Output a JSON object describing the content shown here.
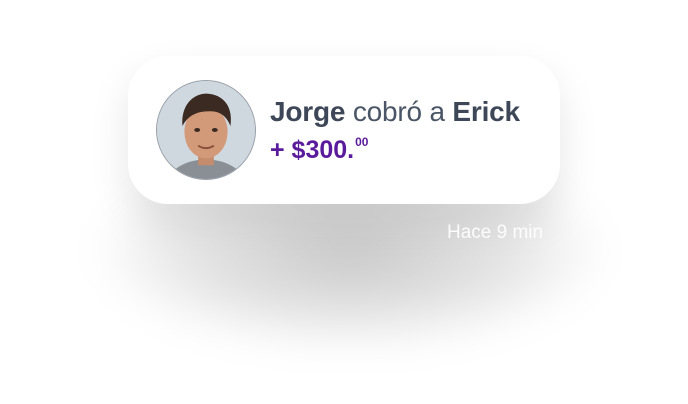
{
  "notification": {
    "sender": "Jorge",
    "verb": " cobró a ",
    "recipient": "Erick",
    "amount_main": "+ $300.",
    "amount_cents": "00",
    "time_ago": "Hace 9 min"
  },
  "colors": {
    "amount": "#5a1a9c",
    "text": "#4a5566"
  },
  "icons": {
    "avatar": "person-avatar-photo"
  }
}
